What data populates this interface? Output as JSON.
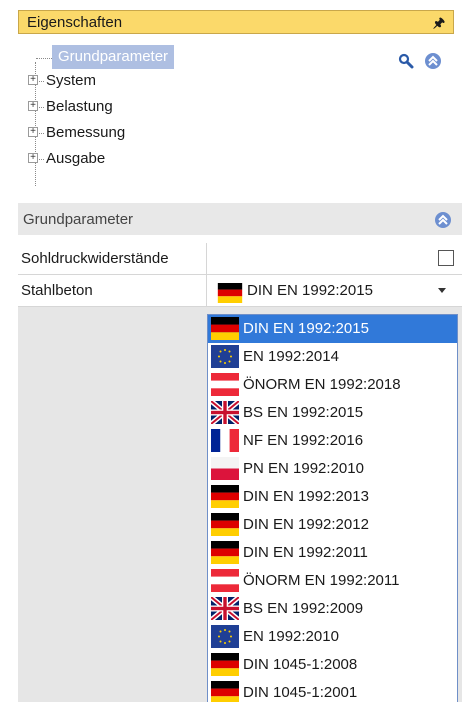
{
  "panel": {
    "title": "Eigenschaften",
    "pin_glyph": "🖈"
  },
  "tree": {
    "selected": "Grundparameter",
    "items": [
      {
        "label": "System",
        "expander": "+"
      },
      {
        "label": "Belastung",
        "expander": "+"
      },
      {
        "label": "Bemessung",
        "expander": "+"
      },
      {
        "label": "Ausgabe",
        "expander": "+"
      }
    ],
    "icons": [
      "search-icon",
      "collapse-up-icon"
    ]
  },
  "section": {
    "title": "Grundparameter"
  },
  "properties": [
    {
      "label": "Sohldruckwiderstände",
      "type": "checkbox",
      "checked": false
    },
    {
      "label": "Stahlbeton",
      "type": "select",
      "value": "DIN EN 1992:2015",
      "flag": "de"
    }
  ],
  "dropdown_options": [
    {
      "label": "DIN EN 1992:2015",
      "flag": "de",
      "selected": true
    },
    {
      "label": "EN 1992:2014",
      "flag": "eu"
    },
    {
      "label": "ÖNORM EN 1992:2018",
      "flag": "at"
    },
    {
      "label": "BS EN 1992:2015",
      "flag": "gb"
    },
    {
      "label": "NF EN 1992:2016",
      "flag": "fr"
    },
    {
      "label": "PN EN 1992:2010",
      "flag": "pl"
    },
    {
      "label": "DIN EN 1992:2013",
      "flag": "de"
    },
    {
      "label": "DIN EN 1992:2012",
      "flag": "de"
    },
    {
      "label": "DIN EN 1992:2011",
      "flag": "de"
    },
    {
      "label": "ÖNORM EN 1992:2011",
      "flag": "at"
    },
    {
      "label": "BS EN 1992:2009",
      "flag": "gb"
    },
    {
      "label": "EN 1992:2010",
      "flag": "eu"
    },
    {
      "label": "DIN 1045-1:2008",
      "flag": "de"
    },
    {
      "label": "DIN 1045-1:2001",
      "flag": "de"
    }
  ],
  "colors": {
    "title_bar": "#fbd96a",
    "tree_selection": "#aebfe2",
    "dropdown_selection": "#3179d9",
    "panel_background": "#e6e6e6"
  }
}
